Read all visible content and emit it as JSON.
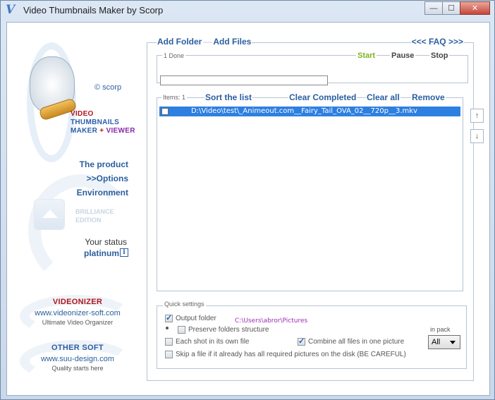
{
  "window": {
    "title": "Video Thumbnails Maker by Scorp",
    "icon_letter": "V",
    "controls": {
      "minimize": "—",
      "maximize": "☐",
      "close": "✕"
    }
  },
  "sidebar": {
    "copyright": "© scorp",
    "logo_lines": {
      "line1": "VIDEO",
      "line2": "THUMBNAILS",
      "line3_a": "MAKER",
      "line3_b": " + ",
      "line3_c": "VIEWER"
    },
    "nav": [
      {
        "label": "The product"
      },
      {
        "label": ">>Options"
      },
      {
        "label": "Environment"
      }
    ],
    "edition": {
      "line1": "BRILLIANCE",
      "line2": "EDITION"
    },
    "status_label": "Your status",
    "status_value": "platinum",
    "info_glyph": "i",
    "videonizer": {
      "title": "VIDEONIZER",
      "url": "www.videonizer-soft.com",
      "tagline": "Ultimate Video Organizer"
    },
    "othersoft": {
      "title": "OTHER SOFT",
      "url": "www.suu-design.com",
      "tagline": "Quality starts here"
    }
  },
  "toolbar": {
    "add_folder": "Add Folder",
    "add_files": "Add Files",
    "faq": "<<< FAQ >>>"
  },
  "progress": {
    "done_label": "1 Done",
    "start": "Start",
    "pause": "Pause",
    "stop": "Stop"
  },
  "list": {
    "items_label": "Items: 1",
    "sort": "Sort the list",
    "clear_completed": "Clear Completed",
    "clear_all": "Clear all",
    "remove": "Remove",
    "rows": [
      {
        "file": "D:\\Video\\test\\_Animeout.com__Fairy_Tail_OVA_02__720p__3.mkv",
        "selected": true
      }
    ],
    "up_arrow": "↑",
    "down_arrow": "↓"
  },
  "quick_settings": {
    "title": "Quick settings",
    "output_folder": "Output  folder",
    "output_path": "C:\\Users\\abror\\Pictures",
    "preserve": "Preserve folders structure",
    "each_shot": "Each shot in its own file",
    "combine": "Combine all files in one picture",
    "skip": "Skip a file if it already has all required pictures on the disk (BE CAREFUL)",
    "in_pack_label": "in pack",
    "in_pack_value": "All",
    "checked": {
      "output_folder": true,
      "preserve": false,
      "each_shot": false,
      "combine": true,
      "skip": false
    }
  },
  "colors": {
    "link": "#2b5f9e",
    "start": "#7fb11f",
    "selection": "#2d7fe0",
    "path": "#9b2eb3",
    "brand_red": "#b0161c"
  }
}
